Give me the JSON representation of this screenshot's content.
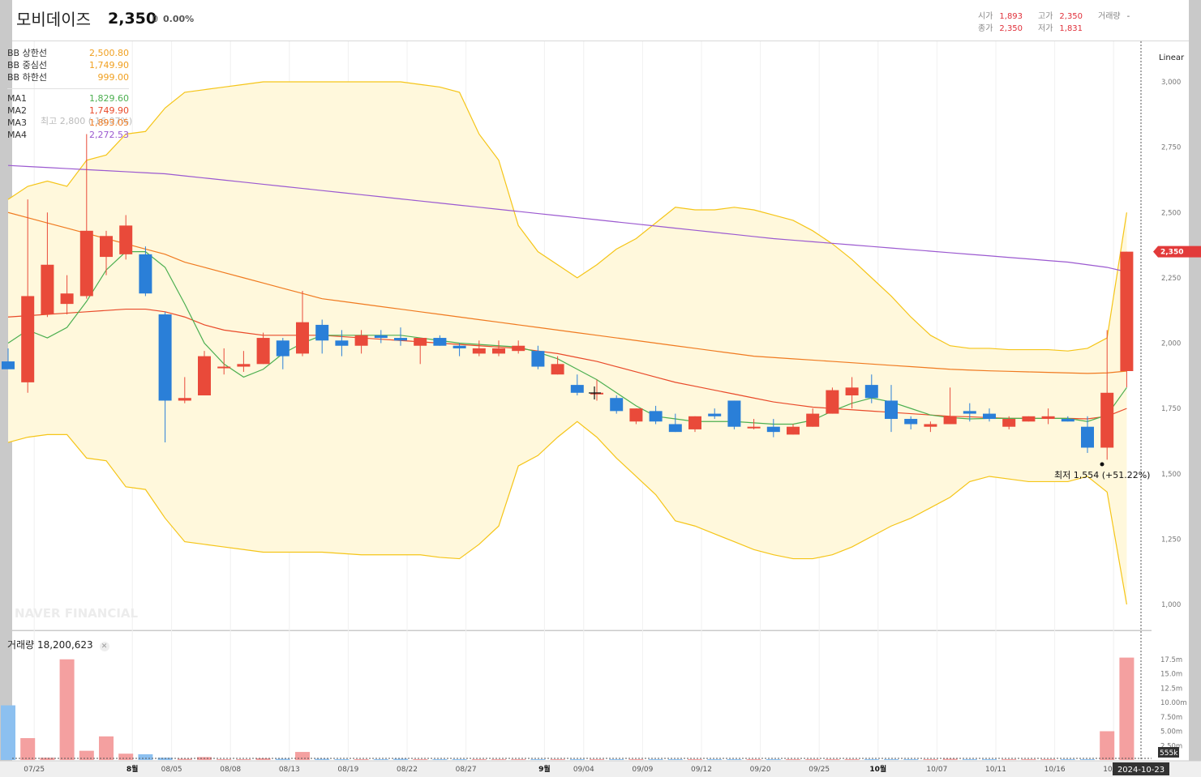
{
  "header": {
    "name": "모비데이즈",
    "price": "2,350",
    "change": "0",
    "rate": "0.00%",
    "ohlc": {
      "open_label": "시가",
      "open": "1,893",
      "high_label": "고가",
      "high": "2,350",
      "volume_label": "거래량",
      "volume": "-",
      "close_label": "종가",
      "close": "2,350",
      "low_label": "저가",
      "low": "1,831"
    }
  },
  "scale_mode": "Linear",
  "legend": {
    "bb": [
      {
        "label": "BB 상한선",
        "value": "2,500.80",
        "color": "#f0a020"
      },
      {
        "label": "BB 중심선",
        "value": "1,749.90",
        "color": "#f0a020"
      },
      {
        "label": "BB 하한선",
        "value": "999.00",
        "color": "#f0a020"
      }
    ],
    "ma": [
      {
        "label": "MA1",
        "value": "1,829.60",
        "color": "#4caf50"
      },
      {
        "label": "MA2",
        "value": "1,749.90",
        "color": "#e94a2a"
      },
      {
        "label": "MA3",
        "value": "1,893.05",
        "color": "#f07a20"
      },
      {
        "label": "MA4",
        "value": "2,272.53",
        "color": "#9b59d0"
      }
    ]
  },
  "annotations": {
    "max_label": "최고 2,800 (-16.07%)",
    "min_label": "최저 1,554 (+51.22%)",
    "current_price_tag": "2,350",
    "volume_tag": "555k",
    "date_tag": "2024-10-23",
    "watermark": "NAVER FINANCIAL"
  },
  "volume_title": "거래량",
  "volume_value": "18,200,623",
  "colors": {
    "up": "#e94a3a",
    "down": "#2a7fd8",
    "bb_fill": "#fff8dc",
    "bb_line": "#f5c518"
  },
  "chart_data": {
    "type": "candlestick",
    "price_axis": {
      "min": 1000,
      "max": 3000,
      "ticks": [
        "3,000",
        "2,750",
        "2,500",
        "2,250",
        "2,000",
        "1,750",
        "1,500",
        "1,250",
        "1,000"
      ]
    },
    "volume_axis": {
      "ticks": [
        "17.5m",
        "15.0m",
        "12.5m",
        "10.00m",
        "7.50m",
        "5.00m",
        "2.50m"
      ]
    },
    "x_labels": [
      {
        "i": 1,
        "label": "07/25"
      },
      {
        "i": 6,
        "label": "8월",
        "bold": true
      },
      {
        "i": 8,
        "label": "08/05"
      },
      {
        "i": 11,
        "label": "08/08"
      },
      {
        "i": 14,
        "label": "08/13"
      },
      {
        "i": 17,
        "label": "08/19"
      },
      {
        "i": 20,
        "label": "08/22"
      },
      {
        "i": 23,
        "label": "08/27"
      },
      {
        "i": 27,
        "label": "9월",
        "bold": true
      },
      {
        "i": 29,
        "label": "09/04"
      },
      {
        "i": 32,
        "label": "09/09"
      },
      {
        "i": 35,
        "label": "09/12"
      },
      {
        "i": 38,
        "label": "09/20"
      },
      {
        "i": 41,
        "label": "09/25"
      },
      {
        "i": 44,
        "label": "10월",
        "bold": true
      },
      {
        "i": 47,
        "label": "10/07"
      },
      {
        "i": 50,
        "label": "10/11"
      },
      {
        "i": 53,
        "label": "10/16"
      },
      {
        "i": 56,
        "label": "10/21"
      }
    ],
    "candles": [
      {
        "o": 1930,
        "h": 1980,
        "l": 1920,
        "c": 1900
      },
      {
        "o": 1850,
        "h": 2550,
        "l": 1810,
        "c": 2180
      },
      {
        "o": 2110,
        "h": 2500,
        "l": 2100,
        "c": 2300
      },
      {
        "o": 2150,
        "h": 2260,
        "l": 2110,
        "c": 2190
      },
      {
        "o": 2180,
        "h": 2800,
        "l": 2170,
        "c": 2430
      },
      {
        "o": 2330,
        "h": 2430,
        "l": 2260,
        "c": 2410
      },
      {
        "o": 2340,
        "h": 2490,
        "l": 2320,
        "c": 2450
      },
      {
        "o": 2340,
        "h": 2370,
        "l": 2180,
        "c": 2190
      },
      {
        "o": 2110,
        "h": 2120,
        "l": 1620,
        "c": 1780
      },
      {
        "o": 1780,
        "h": 1870,
        "l": 1770,
        "c": 1790
      },
      {
        "o": 1800,
        "h": 1970,
        "l": 1800,
        "c": 1950
      },
      {
        "o": 1910,
        "h": 1980,
        "l": 1880,
        "c": 1910
      },
      {
        "o": 1910,
        "h": 1970,
        "l": 1890,
        "c": 1920
      },
      {
        "o": 1920,
        "h": 2040,
        "l": 1920,
        "c": 2020
      },
      {
        "o": 2010,
        "h": 2020,
        "l": 1900,
        "c": 1950
      },
      {
        "o": 1960,
        "h": 2200,
        "l": 1950,
        "c": 2080
      },
      {
        "o": 2070,
        "h": 2090,
        "l": 1960,
        "c": 2010
      },
      {
        "o": 2010,
        "h": 2050,
        "l": 1950,
        "c": 1990
      },
      {
        "o": 1990,
        "h": 2050,
        "l": 1960,
        "c": 2030
      },
      {
        "o": 2030,
        "h": 2050,
        "l": 2000,
        "c": 2020
      },
      {
        "o": 2020,
        "h": 2060,
        "l": 1990,
        "c": 2010
      },
      {
        "o": 1990,
        "h": 2020,
        "l": 1920,
        "c": 2020
      },
      {
        "o": 2020,
        "h": 2030,
        "l": 1990,
        "c": 1990
      },
      {
        "o": 1990,
        "h": 2000,
        "l": 1950,
        "c": 1980
      },
      {
        "o": 1960,
        "h": 2010,
        "l": 1950,
        "c": 1980
      },
      {
        "o": 1960,
        "h": 2010,
        "l": 1950,
        "c": 1980
      },
      {
        "o": 1970,
        "h": 2010,
        "l": 1960,
        "c": 1990
      },
      {
        "o": 1970,
        "h": 1990,
        "l": 1900,
        "c": 1910
      },
      {
        "o": 1880,
        "h": 1950,
        "l": 1880,
        "c": 1920
      },
      {
        "o": 1840,
        "h": 1880,
        "l": 1800,
        "c": 1810
      },
      {
        "o": 1810,
        "h": 1860,
        "l": 1780,
        "c": 1810
      },
      {
        "o": 1790,
        "h": 1800,
        "l": 1730,
        "c": 1740
      },
      {
        "o": 1700,
        "h": 1750,
        "l": 1690,
        "c": 1750
      },
      {
        "o": 1740,
        "h": 1760,
        "l": 1690,
        "c": 1700
      },
      {
        "o": 1690,
        "h": 1730,
        "l": 1660,
        "c": 1660
      },
      {
        "o": 1670,
        "h": 1720,
        "l": 1660,
        "c": 1720
      },
      {
        "o": 1730,
        "h": 1750,
        "l": 1710,
        "c": 1720
      },
      {
        "o": 1780,
        "h": 1780,
        "l": 1670,
        "c": 1680
      },
      {
        "o": 1680,
        "h": 1710,
        "l": 1670,
        "c": 1680
      },
      {
        "o": 1680,
        "h": 1710,
        "l": 1640,
        "c": 1660
      },
      {
        "o": 1650,
        "h": 1690,
        "l": 1650,
        "c": 1680
      },
      {
        "o": 1680,
        "h": 1750,
        "l": 1680,
        "c": 1730
      },
      {
        "o": 1730,
        "h": 1830,
        "l": 1730,
        "c": 1820
      },
      {
        "o": 1800,
        "h": 1870,
        "l": 1750,
        "c": 1830
      },
      {
        "o": 1840,
        "h": 1880,
        "l": 1770,
        "c": 1790
      },
      {
        "o": 1780,
        "h": 1840,
        "l": 1660,
        "c": 1710
      },
      {
        "o": 1710,
        "h": 1720,
        "l": 1670,
        "c": 1690
      },
      {
        "o": 1680,
        "h": 1700,
        "l": 1660,
        "c": 1690
      },
      {
        "o": 1690,
        "h": 1830,
        "l": 1690,
        "c": 1720
      },
      {
        "o": 1740,
        "h": 1770,
        "l": 1700,
        "c": 1730
      },
      {
        "o": 1730,
        "h": 1750,
        "l": 1700,
        "c": 1710
      },
      {
        "o": 1680,
        "h": 1720,
        "l": 1670,
        "c": 1710
      },
      {
        "o": 1700,
        "h": 1720,
        "l": 1700,
        "c": 1720
      },
      {
        "o": 1710,
        "h": 1750,
        "l": 1690,
        "c": 1720
      },
      {
        "o": 1710,
        "h": 1720,
        "l": 1700,
        "c": 1700
      },
      {
        "o": 1680,
        "h": 1720,
        "l": 1580,
        "c": 1600
      },
      {
        "o": 1600,
        "h": 2050,
        "l": 1554,
        "c": 1810
      },
      {
        "o": 1893,
        "h": 2350,
        "l": 1831,
        "c": 2350
      }
    ],
    "volumes_m": [
      9.5,
      3.8,
      0.4,
      17.5,
      1.6,
      4.1,
      1.1,
      1.0,
      0.4,
      0.2,
      0.5,
      0.1,
      0.1,
      0.3,
      0.2,
      1.4,
      0.2,
      0.1,
      0.1,
      0.1,
      0.2,
      0.1,
      0.1,
      0.1,
      0.1,
      0.1,
      0.1,
      0.1,
      0.1,
      0.1,
      0.1,
      0.1,
      0.1,
      0.1,
      0.1,
      0.1,
      0.1,
      0.1,
      0.1,
      0.1,
      0.1,
      0.1,
      0.1,
      0.1,
      0.1,
      0.1,
      0.1,
      0.1,
      0.2,
      0.1,
      0.1,
      0.1,
      0.1,
      0.1,
      0.1,
      0.1,
      5.0,
      17.8
    ],
    "bb_upper": [
      2550,
      2600,
      2620,
      2600,
      2700,
      2720,
      2800,
      2810,
      2900,
      2960,
      2970,
      2980,
      2990,
      3000,
      3000,
      3000,
      3000,
      3000,
      3000,
      3000,
      3000,
      2990,
      2980,
      2960,
      2800,
      2700,
      2450,
      2350,
      2300,
      2250,
      2300,
      2360,
      2400,
      2460,
      2520,
      2510,
      2510,
      2520,
      2510,
      2490,
      2470,
      2430,
      2380,
      2320,
      2250,
      2180,
      2100,
      2030,
      1990,
      1980,
      1980,
      1975,
      1975,
      1975,
      1970,
      1980,
      2020,
      2500
    ],
    "bb_lower": [
      1620,
      1640,
      1650,
      1650,
      1560,
      1550,
      1450,
      1440,
      1330,
      1240,
      1230,
      1220,
      1210,
      1200,
      1200,
      1200,
      1200,
      1195,
      1190,
      1190,
      1190,
      1190,
      1180,
      1175,
      1230,
      1300,
      1530,
      1570,
      1640,
      1700,
      1640,
      1560,
      1490,
      1420,
      1320,
      1300,
      1270,
      1240,
      1210,
      1190,
      1175,
      1175,
      1190,
      1220,
      1260,
      1300,
      1330,
      1370,
      1410,
      1470,
      1490,
      1480,
      1470,
      1470,
      1470,
      1490,
      1430,
      1000
    ],
    "ma1": [
      2000,
      2050,
      2020,
      2060,
      2160,
      2280,
      2350,
      2350,
      2290,
      2150,
      2000,
      1920,
      1870,
      1900,
      1960,
      2000,
      2030,
      2030,
      2030,
      2030,
      2030,
      2020,
      2010,
      2000,
      1995,
      1990,
      1985,
      1965,
      1940,
      1900,
      1860,
      1810,
      1760,
      1720,
      1710,
      1700,
      1700,
      1700,
      1695,
      1690,
      1690,
      1705,
      1740,
      1770,
      1790,
      1775,
      1750,
      1725,
      1715,
      1710,
      1712,
      1712,
      1712,
      1712,
      1712,
      1700,
      1725,
      1830
    ],
    "ma2": [
      2100,
      2105,
      2110,
      2115,
      2120,
      2125,
      2130,
      2130,
      2120,
      2100,
      2070,
      2050,
      2040,
      2030,
      2030,
      2030,
      2030,
      2025,
      2020,
      2015,
      2010,
      2005,
      2000,
      1995,
      1990,
      1985,
      1980,
      1970,
      1960,
      1945,
      1930,
      1910,
      1890,
      1870,
      1850,
      1835,
      1820,
      1805,
      1790,
      1775,
      1765,
      1755,
      1750,
      1745,
      1740,
      1735,
      1730,
      1725,
      1720,
      1718,
      1715,
      1712,
      1712,
      1712,
      1712,
      1710,
      1720,
      1750
    ],
    "ma3": [
      2500,
      2480,
      2460,
      2440,
      2420,
      2400,
      2380,
      2360,
      2340,
      2310,
      2290,
      2270,
      2250,
      2230,
      2210,
      2190,
      2170,
      2160,
      2150,
      2140,
      2130,
      2120,
      2110,
      2100,
      2090,
      2080,
      2070,
      2060,
      2050,
      2040,
      2030,
      2020,
      2010,
      2000,
      1990,
      1980,
      1970,
      1960,
      1950,
      1945,
      1940,
      1935,
      1930,
      1925,
      1920,
      1915,
      1910,
      1905,
      1900,
      1897,
      1894,
      1892,
      1890,
      1888,
      1886,
      1884,
      1886,
      1893
    ],
    "ma4": [
      2680,
      2676,
      2672,
      2668,
      2664,
      2660,
      2656,
      2652,
      2648,
      2640,
      2632,
      2624,
      2616,
      2608,
      2600,
      2592,
      2584,
      2576,
      2568,
      2560,
      2552,
      2544,
      2536,
      2528,
      2520,
      2512,
      2504,
      2496,
      2488,
      2480,
      2472,
      2464,
      2456,
      2448,
      2440,
      2432,
      2424,
      2416,
      2408,
      2400,
      2394,
      2388,
      2382,
      2376,
      2370,
      2364,
      2358,
      2352,
      2346,
      2340,
      2334,
      2328,
      2322,
      2316,
      2310,
      2300,
      2290,
      2272.53
    ]
  }
}
